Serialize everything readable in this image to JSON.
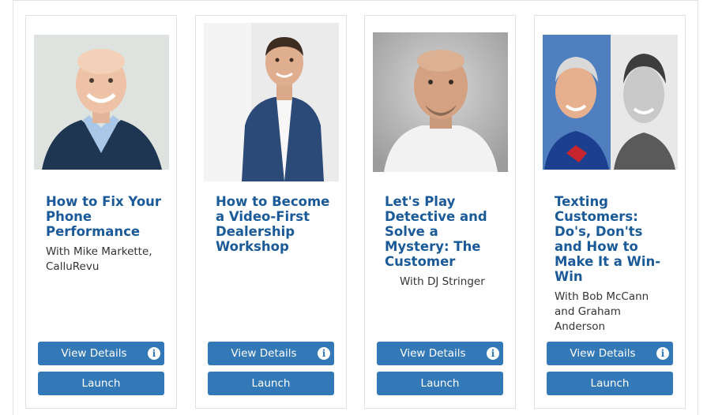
{
  "webinars": [
    {
      "title": "How to Fix Your Phone Performance",
      "presenter": "With Mike Markette, CalluRevu",
      "details_label": "View Details",
      "launch_label": "Launch"
    },
    {
      "title": "How to Become a Video-First Dealership Workshop",
      "presenter": "",
      "details_label": "View Details",
      "launch_label": "Launch"
    },
    {
      "title": "Let's Play Detective and Solve a Mystery: The Customer",
      "presenter": "With DJ Stringer",
      "details_label": "View Details",
      "launch_label": "Launch"
    },
    {
      "title": "Texting Customers: Do's, Don'ts and How to Make It a Win-Win",
      "presenter": "With Bob McCann and Graham Anderson",
      "details_label": "View Details",
      "launch_label": "Launch"
    }
  ],
  "colors": {
    "title": "#1a5a98",
    "button": "#3479b7",
    "border": "#e1e1e1"
  },
  "icons": {
    "info": "info-icon"
  }
}
